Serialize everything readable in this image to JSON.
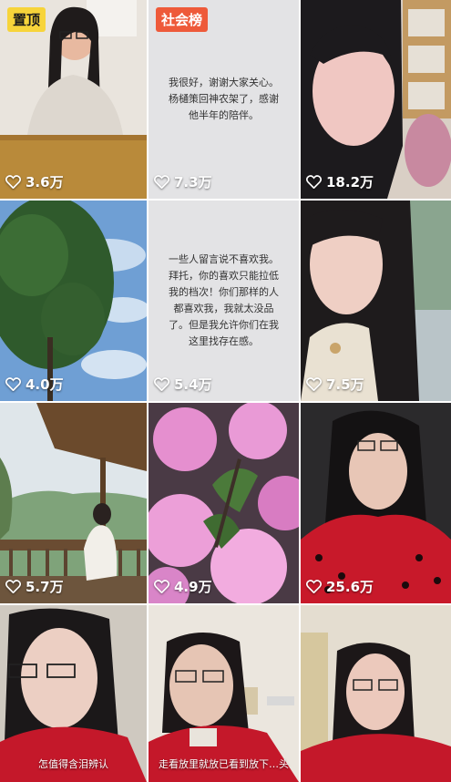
{
  "videos": [
    {
      "badge": "置顶",
      "likes": "3.6万"
    },
    {
      "badge": "社会榜",
      "text": "我很好，谢谢大家关心。杨樋策回神农架了，感谢他半年的陪伴。",
      "likes": "7.3万"
    },
    {
      "likes": "18.2万"
    },
    {
      "likes": "4.0万"
    },
    {
      "text": "一些人留言说不喜欢我。拜托，你的喜欢只能拉低我的档次！你们那样的人都喜欢我，我就太没品了。但是我允许你们在我这里找存在感。",
      "likes": "5.4万"
    },
    {
      "likes": "7.5万"
    },
    {
      "likes": "5.7万"
    },
    {
      "likes": "4.9万"
    },
    {
      "likes": "25.6万"
    },
    {
      "caption": "怎值得含泪辨认"
    },
    {
      "caption": "走看放里就放已看到放下…头"
    },
    {}
  ],
  "colors": {
    "pin_badge": "#f7d43a",
    "social_badge": "#ee5a3a"
  },
  "icons": {
    "like": "heart-outline-icon"
  }
}
